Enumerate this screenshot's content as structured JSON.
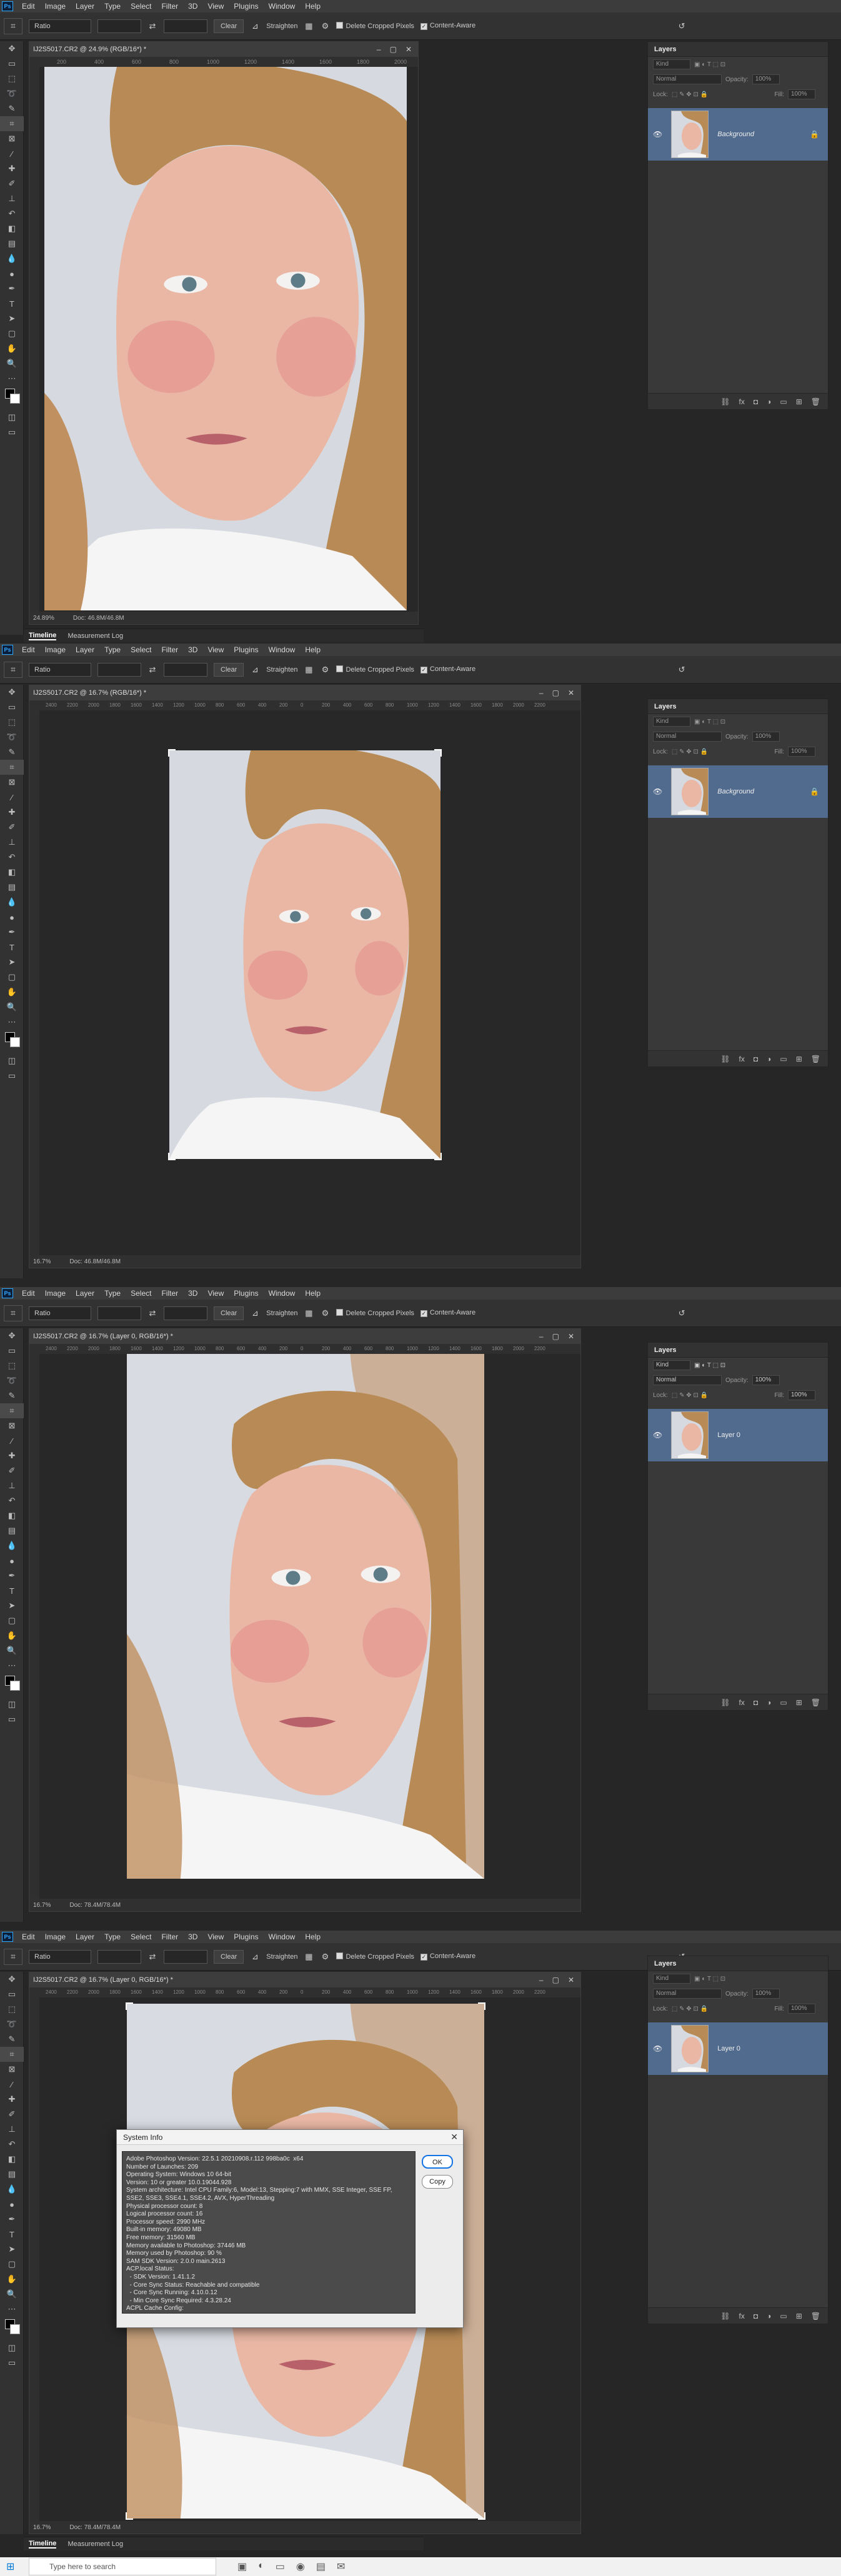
{
  "menu": [
    "Edit",
    "Image",
    "Layer",
    "Type",
    "Select",
    "Filter",
    "3D",
    "View",
    "Plugins",
    "Window",
    "Help"
  ],
  "app_badge": "Ps",
  "options": {
    "ratio": "Ratio",
    "clear": "Clear",
    "straighten": "Straighten",
    "delete_cropped": "Delete Cropped Pixels",
    "content_aware": "Content-Aware"
  },
  "ruler_ticks": [
    "200",
    "400",
    "600",
    "800",
    "1000",
    "1200",
    "1400",
    "1600",
    "1800",
    "2000",
    "2200"
  ],
  "ruler_ticks_wide": [
    "2400",
    "2200",
    "2000",
    "1800",
    "1600",
    "1400",
    "1200",
    "1000",
    "800",
    "600",
    "400",
    "200",
    "0",
    "200",
    "400",
    "600",
    "800",
    "1000",
    "1200",
    "1400",
    "1600",
    "1800",
    "2000",
    "2200",
    "2400"
  ],
  "screens": [
    {
      "doc_title": "IJ2S5017.CR2 @ 24.9% (RGB/16*) *",
      "zoom": "24.89%",
      "doc": "Doc: 46.8M/46.8M",
      "layer": "Background"
    },
    {
      "doc_title": "IJ2S5017.CR2 @ 16.7% (RGB/16*) *",
      "zoom": "16.7%",
      "doc": "Doc: 46.8M/46.8M",
      "layer": "Background"
    },
    {
      "doc_title": "IJ2S5017.CR2 @ 16.7% (Layer 0, RGB/16*) *",
      "zoom": "16.7%",
      "doc": "Doc: 78.4M/78.4M",
      "layer": "Layer 0"
    },
    {
      "doc_title": "IJ2S5017.CR2 @ 16.7% (Layer 0, RGB/16*) *",
      "zoom": "16.7%",
      "doc": "Doc: 78.4M/78.4M",
      "layer": "Layer 0"
    }
  ],
  "timeline": {
    "tab1": "Timeline",
    "tab2": "Measurement Log"
  },
  "layers_panel": {
    "title": "Layers",
    "kind": "Kind",
    "blend": "Normal",
    "opacity_label": "Opacity:",
    "opacity": "100%",
    "lock_label": "Lock:",
    "fill_label": "Fill:",
    "fill": "100%"
  },
  "dialog": {
    "title": "System Info",
    "ok": "OK",
    "copy": "Copy",
    "text": "Adobe Photoshop Version: 22.5.1 20210908.r.112 998ba0c  x64\nNumber of Launches: 209\nOperating System: Windows 10 64-bit\nVersion: 10 or greater 10.0.19044.928\nSystem architecture: Intel CPU Family:6, Model:13, Stepping:7 with MMX, SSE Integer, SSE FP,\nSSE2, SSE3, SSE4.1, SSE4.2, AVX, HyperThreading\nPhysical processor count: 8\nLogical processor count: 16\nProcessor speed: 2990 MHz\nBuilt-in memory: 49080 MB\nFree memory: 31560 MB\nMemory available to Photoshop: 37446 MB\nMemory used by Photoshop: 90 %\nSAM SDK Version: 2.0.0 main.2613\nACP.local Status:\n  - SDK Version: 1.41.1.2\n  - Core Sync Status: Reachable and compatible\n  - Core Sync Running: 4.10.0.12\n  - Min Core Sync Required: 4.3.28.24\nACPL Cache Config:\n  - Time to Live: 5184000 seconds\n  - Max Size: 20480 MB"
  },
  "taskbar": {
    "search_placeholder": "Type here to search"
  }
}
